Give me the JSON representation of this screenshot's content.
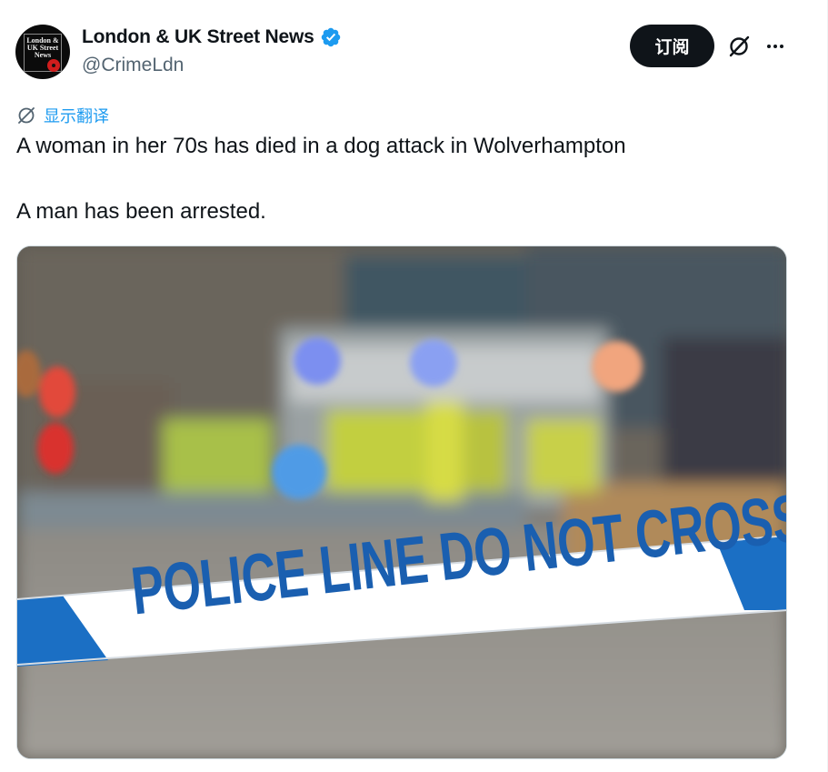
{
  "author": {
    "display_name": "London & UK Street News",
    "handle": "@CrimeLdn",
    "avatar_text": "London &\nUK Street\nNews",
    "verified": true
  },
  "actions": {
    "subscribe_label": "订阅",
    "grok_icon": "grok-icon",
    "more_icon": "more-icon"
  },
  "translate": {
    "label": "显示翻译",
    "icon": "globe-icon"
  },
  "tweet": {
    "line1": "A woman in her 70s has died in a dog attack in Wolverhampton",
    "line2": "A man has been arrested."
  },
  "media": {
    "tape_text": "POLICE LINE DO NOT CROSS"
  },
  "colors": {
    "accent": "#1d9bf0",
    "text": "#0f1419",
    "secondary": "#536471",
    "tape_blue": "#1a5fb0"
  }
}
